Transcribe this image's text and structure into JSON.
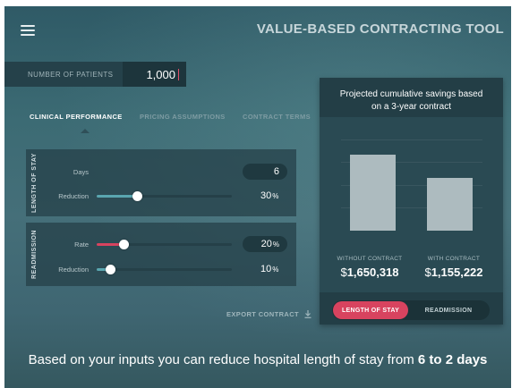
{
  "header": {
    "title": "VALUE-BASED CONTRACTING TOOL",
    "menu_icon": "hamburger-menu-icon"
  },
  "patients": {
    "label": "NUMBER OF PATIENTS",
    "value": "1,000"
  },
  "tabs": [
    {
      "label": "CLINICAL PERFORMANCE",
      "active": true
    },
    {
      "label": "PRICING ASSUMPTIONS",
      "active": false
    },
    {
      "label": "CONTRACT TERMS",
      "active": false
    }
  ],
  "length_of_stay": {
    "section_label": "LENGTH OF STAY",
    "days_label": "Days",
    "days_value": "6",
    "reduction_label": "Reduction",
    "reduction_value": "30",
    "reduction_unit": "%",
    "reduction_slider": 0.3
  },
  "readmission": {
    "section_label": "READMISSION",
    "rate_label": "Rate",
    "rate_value": "20",
    "rate_unit": "%",
    "rate_slider": 0.2,
    "reduction_label": "Reduction",
    "reduction_value": "10",
    "reduction_unit": "%",
    "reduction_slider": 0.1
  },
  "export": {
    "label": "EXPORT CONTRACT",
    "icon": "download-icon"
  },
  "summary": {
    "text": "Based on your inputs you can reduce hospital length of stay from",
    "highlight": "6 to 2 days"
  },
  "savings_card": {
    "title": "Projected cumulative savings based on a 3-year contract",
    "toggle_active": "LENGTH OF STAY",
    "toggle_inactive": "READMISSION"
  },
  "chart_data": {
    "type": "bar",
    "categories": [
      "WITHOUT CONTRACT",
      "WITH CONTRACT"
    ],
    "values": [
      1650318,
      1155222
    ],
    "value_labels": [
      "1,650,318",
      "1,155,222"
    ],
    "currency": "$",
    "ylim": [
      0,
      1980000
    ]
  },
  "colors": {
    "accent": "#d8435f",
    "bar": "#adbbbf",
    "background": "#3c6b74"
  }
}
